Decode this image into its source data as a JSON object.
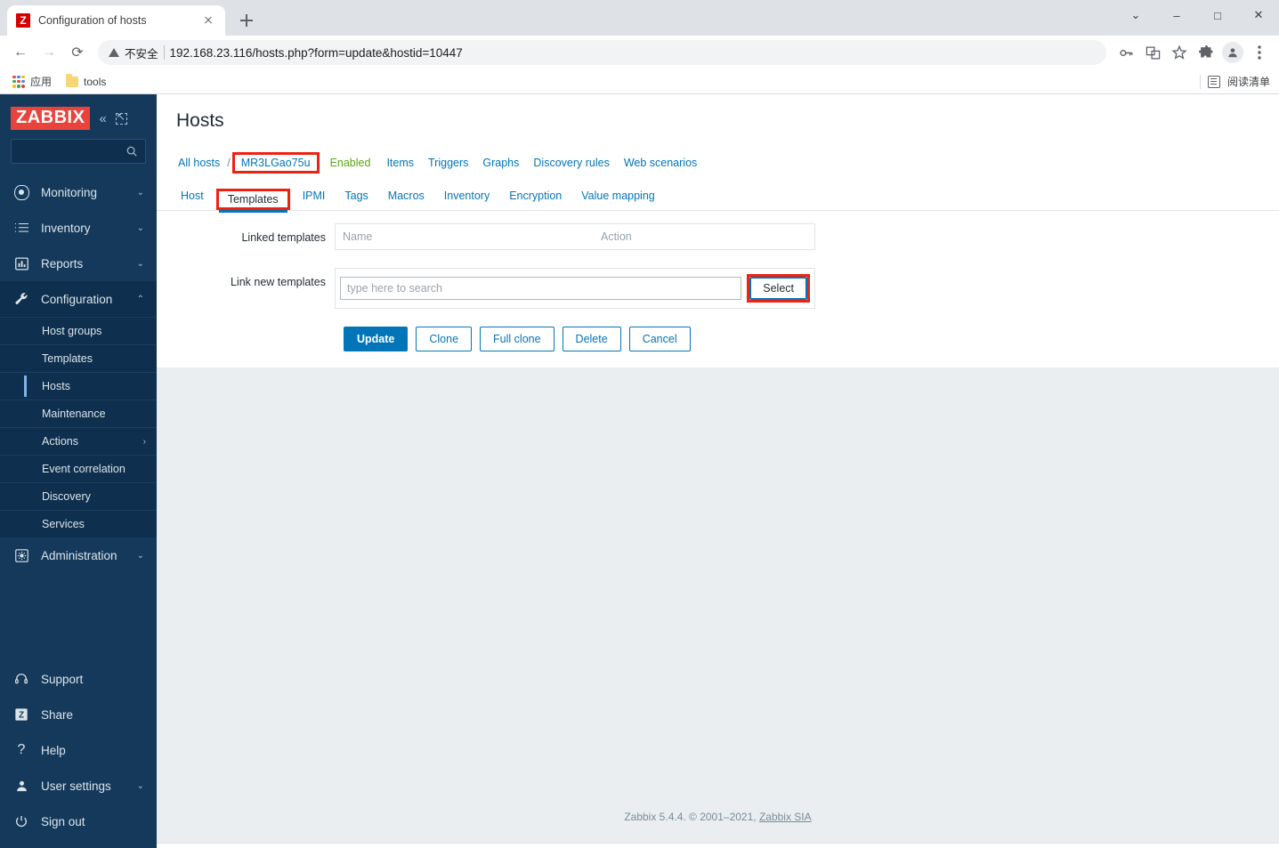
{
  "browser": {
    "tab": {
      "title": "Configuration of hosts",
      "favicon_letter": "Z",
      "favicon_name": "zabbix-favicon"
    },
    "newtab_label": "+",
    "window_controls": {
      "dropdown": "⌄",
      "minimize": "–",
      "maximize": "□",
      "close": "✕"
    },
    "nav": {
      "back": "←",
      "forward": "→",
      "reload": "⟳"
    },
    "omnibox": {
      "security_label": "不安全",
      "url": "192.168.23.116/hosts.php?form=update&hostid=10447"
    },
    "toolbar_icons": [
      "key-icon",
      "translate-icon",
      "star-icon",
      "extensions-icon",
      "profile-icon",
      "chrome-menu-icon"
    ],
    "bookmarks": [
      {
        "label": "应用",
        "icon": "apps-grid-icon"
      },
      {
        "label": "tools",
        "icon": "folder-icon"
      }
    ],
    "reading_list": {
      "label": "阅读清单",
      "icon": "reading-list-icon"
    }
  },
  "sidebar": {
    "logo": "ZABBIX",
    "collapse_icon": "«",
    "search_placeholder": "",
    "menu": [
      {
        "label": "Monitoring",
        "icon": "eye-icon",
        "arrow": "⌄",
        "active": false
      },
      {
        "label": "Inventory",
        "icon": "list-icon",
        "arrow": "⌄",
        "active": false
      },
      {
        "label": "Reports",
        "icon": "chart-bar-icon",
        "arrow": "⌄",
        "active": false
      },
      {
        "label": "Configuration",
        "icon": "wrench-icon",
        "arrow": "⌃",
        "active": true
      }
    ],
    "submenu": [
      {
        "label": "Host groups",
        "selected": false,
        "arrow": ""
      },
      {
        "label": "Templates",
        "selected": false,
        "arrow": ""
      },
      {
        "label": "Hosts",
        "selected": true,
        "arrow": ""
      },
      {
        "label": "Maintenance",
        "selected": false,
        "arrow": ""
      },
      {
        "label": "Actions",
        "selected": false,
        "arrow": "›"
      },
      {
        "label": "Event correlation",
        "selected": false,
        "arrow": ""
      },
      {
        "label": "Discovery",
        "selected": false,
        "arrow": ""
      },
      {
        "label": "Services",
        "selected": false,
        "arrow": ""
      }
    ],
    "menu_after": [
      {
        "label": "Administration",
        "icon": "gear-icon",
        "arrow": "⌄",
        "active": false
      }
    ],
    "bottom": [
      {
        "label": "Support",
        "icon": "headset-icon",
        "arrow": ""
      },
      {
        "label": "Share",
        "icon": "zabbix-square-icon",
        "arrow": ""
      },
      {
        "label": "Help",
        "icon": "question-icon",
        "arrow": ""
      },
      {
        "label": "User settings",
        "icon": "person-icon",
        "arrow": "⌄"
      },
      {
        "label": "Sign out",
        "icon": "power-icon",
        "arrow": ""
      }
    ]
  },
  "page": {
    "title": "Hosts",
    "breadcrumb": {
      "all_hosts": "All hosts",
      "separator": "/",
      "host_name": "MR3LGao75u",
      "status": "Enabled",
      "links": [
        "Items",
        "Triggers",
        "Graphs",
        "Discovery rules",
        "Web scenarios"
      ]
    },
    "tabs": [
      {
        "label": "Host",
        "active": false
      },
      {
        "label": "Templates",
        "active": true
      },
      {
        "label": "IPMI",
        "active": false
      },
      {
        "label": "Tags",
        "active": false
      },
      {
        "label": "Macros",
        "active": false
      },
      {
        "label": "Inventory",
        "active": false
      },
      {
        "label": "Encryption",
        "active": false
      },
      {
        "label": "Value mapping",
        "active": false
      }
    ],
    "form": {
      "linked_templates_label": "Linked templates",
      "linked_columns": {
        "name": "Name",
        "action": "Action"
      },
      "linked_rows": [],
      "link_new_label": "Link new templates",
      "search_placeholder": "type here to search",
      "search_value": "",
      "select_button": "Select"
    },
    "buttons": [
      {
        "label": "Update",
        "primary": true
      },
      {
        "label": "Clone",
        "primary": false
      },
      {
        "label": "Full clone",
        "primary": false
      },
      {
        "label": "Delete",
        "primary": false
      },
      {
        "label": "Cancel",
        "primary": false
      }
    ],
    "footer": {
      "text": "Zabbix 5.4.4. © 2001–2021, ",
      "link": "Zabbix SIA"
    }
  },
  "colors": {
    "accent": "#0275b8",
    "sidebar": "#15395b",
    "logo_red": "#e8443c",
    "highlight_red": "#ee2211",
    "enabled_green": "#59a80f"
  }
}
